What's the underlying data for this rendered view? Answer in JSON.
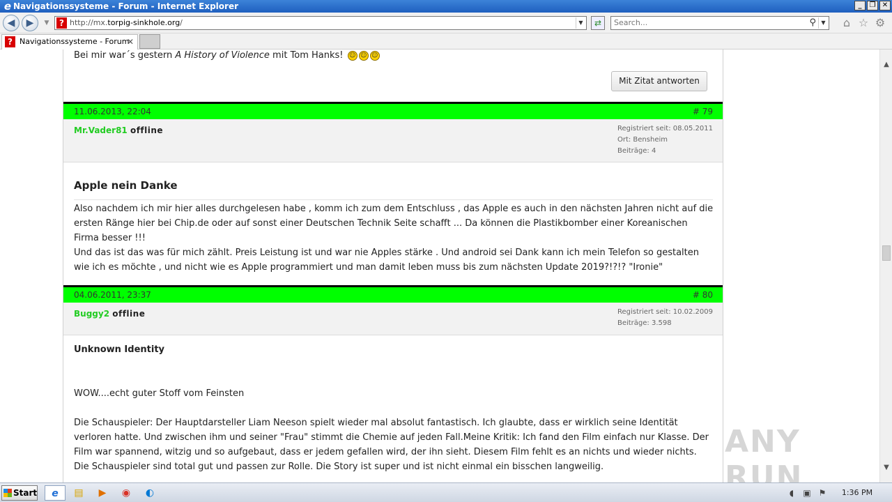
{
  "window": {
    "title": "Navigationssysteme - Forum - Internet Explorer",
    "controls": {
      "minimize": "_",
      "restore": "❐",
      "close": "✕"
    }
  },
  "toolbar": {
    "url_prefix": "http://mx.",
    "url_domain": "torpig-sinkhole.org",
    "url_suffix": "/",
    "search_placeholder": "Search..."
  },
  "tabs": [
    {
      "label": "Navigationssysteme - Forum",
      "close": "✕"
    }
  ],
  "posts": {
    "top": {
      "text_prefix": "Bei mir war´s gestern ",
      "text_title": "A History of Violence",
      "text_suffix": " mit Tom Hanks! ",
      "quote_label": "Mit Zitat antworten"
    },
    "p79": {
      "date": "11.06.2013, 22:04",
      "number": "# 79",
      "username": "Mr.Vader81",
      "status": "offline",
      "info": [
        "Registriert seit: 08.05.2011",
        "Ort: Bensheim",
        "Beiträge: 4"
      ],
      "title": "Apple nein Danke",
      "para1": "Also nachdem ich mir hier alles durchgelesen habe , komm ich zum dem Entschluss , das Apple es auch in den nächsten Jahren nicht auf die ersten Ränge hier bei Chip.de oder auf sonst einer Deutschen Technik Seite schafft ... Da können die Plastikbomber einer Koreanischen Firma besser !!!",
      "para2": "Und das ist das was für mich zählt. Preis Leistung ist und war nie Apples stärke . Und android sei Dank kann ich mein Telefon so gestalten wie ich es möchte , und nicht wie es Apple programmiert und man damit leben muss bis zum nächsten Update 2019?!?!? \"Ironie\""
    },
    "p80": {
      "date": "04.06.2011, 23:37",
      "number": "# 80",
      "username": "Buggy2",
      "status": "offline",
      "info": [
        "Registriert seit: 10.02.2009",
        "Beiträge: 3.598"
      ],
      "title": "Unknown Identity",
      "para1": "WOW....echt guter Stoff vom Feinsten",
      "para2": "Die Schauspieler: Der Hauptdarsteller Liam Neeson spielt wieder mal absolut fantastisch. Ich glaubte, dass er wirklich seine Identität verloren hatte. Und zwischen ihm und seiner \"Frau\" stimmt die Chemie auf jeden Fall.Meine Kritik: Ich fand den Film einfach nur Klasse. Der Film war spannend, witzig und so aufgebaut, dass er jedem gefallen wird, der ihn sieht. Diesem Film fehlt es an nichts und wieder nichts. Die Schauspieler sind total gut und passen zur Rolle. Die Story ist super und ist nicht einmal ein bisschen langweilig."
    }
  },
  "watermark": "ANY RUN",
  "taskbar": {
    "start_label": "Start",
    "clock": "1:36 PM"
  },
  "colors": {
    "post_header": "#00ff00",
    "username": "#22cc22"
  }
}
